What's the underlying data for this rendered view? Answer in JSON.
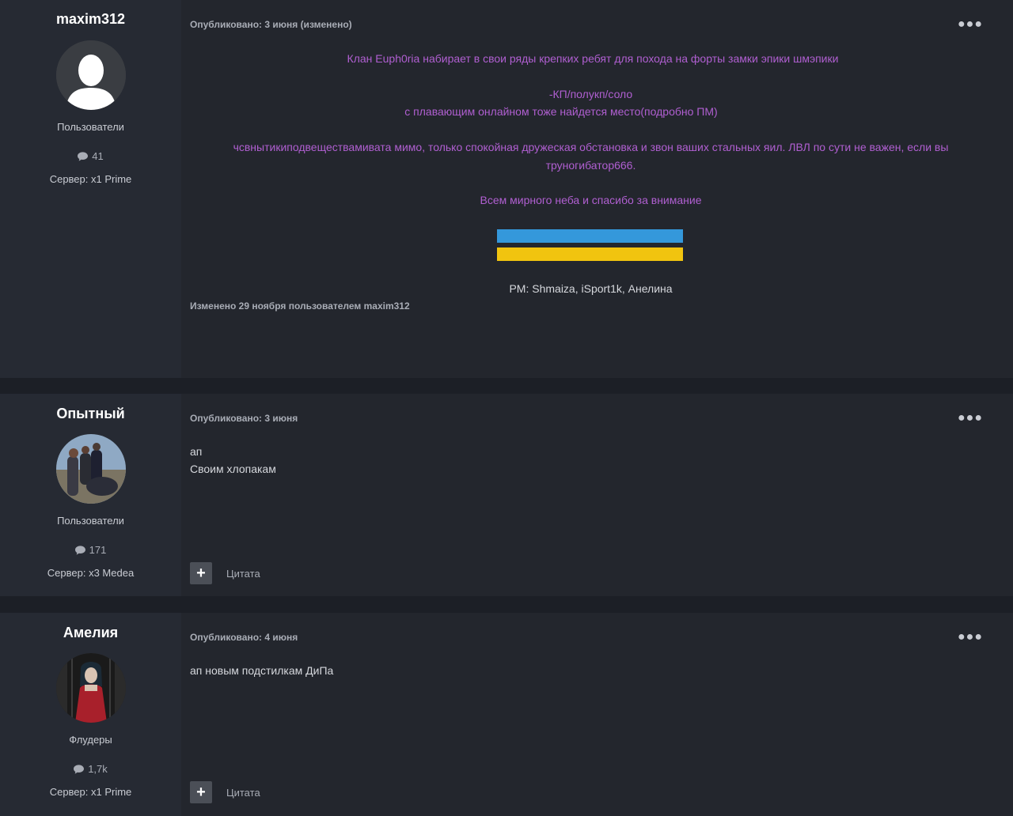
{
  "posts": [
    {
      "author": "maxim312",
      "group": "Пользователи",
      "post_count": "41",
      "server": "Сервер: x1 Prime",
      "posted": "Опубликовано: 3 июня (изменено)",
      "lines": [
        "Клан Euph0ria набирает в свои ряды крепких ребят для похода на форты замки эпики шмэпики",
        "-КП/полукп/соло",
        "с плавающим онлайном тоже найдется место(подробно ПМ)",
        "чсвнытикиподвеществамивата мимо, только спокойная дружеская обстановка и звон ваших стальных яил. ЛВЛ по сути не важен, если вы",
        "труногибатор666.",
        "Всем мирного неба и спасибо за внимание",
        "PM: Shmaiza, iSport1k, Анелина"
      ],
      "edited": "Изменено 29 ноября пользователем maxim312",
      "flag_colors": [
        "#3498db",
        "#f1c40f"
      ]
    },
    {
      "author": "Опытный",
      "group": "Пользователи",
      "post_count": "171",
      "server": "Сервер: x3 Medea",
      "posted": "Опубликовано: 3 июня",
      "lines": [
        "ап",
        "Своим хлопакам"
      ],
      "quote": "Цитата"
    },
    {
      "author": "Амелия",
      "group": "Флудеры",
      "post_count": "1,7k",
      "server": "Сервер: x1 Prime",
      "posted": "Опубликовано: 4 июня",
      "lines": [
        "ап новым подстилкам ДиПа"
      ],
      "quote": "Цитата"
    }
  ],
  "icons": {
    "menu": "more-horizontal-icon",
    "comment": "comment-icon",
    "plus": "plus-icon"
  }
}
